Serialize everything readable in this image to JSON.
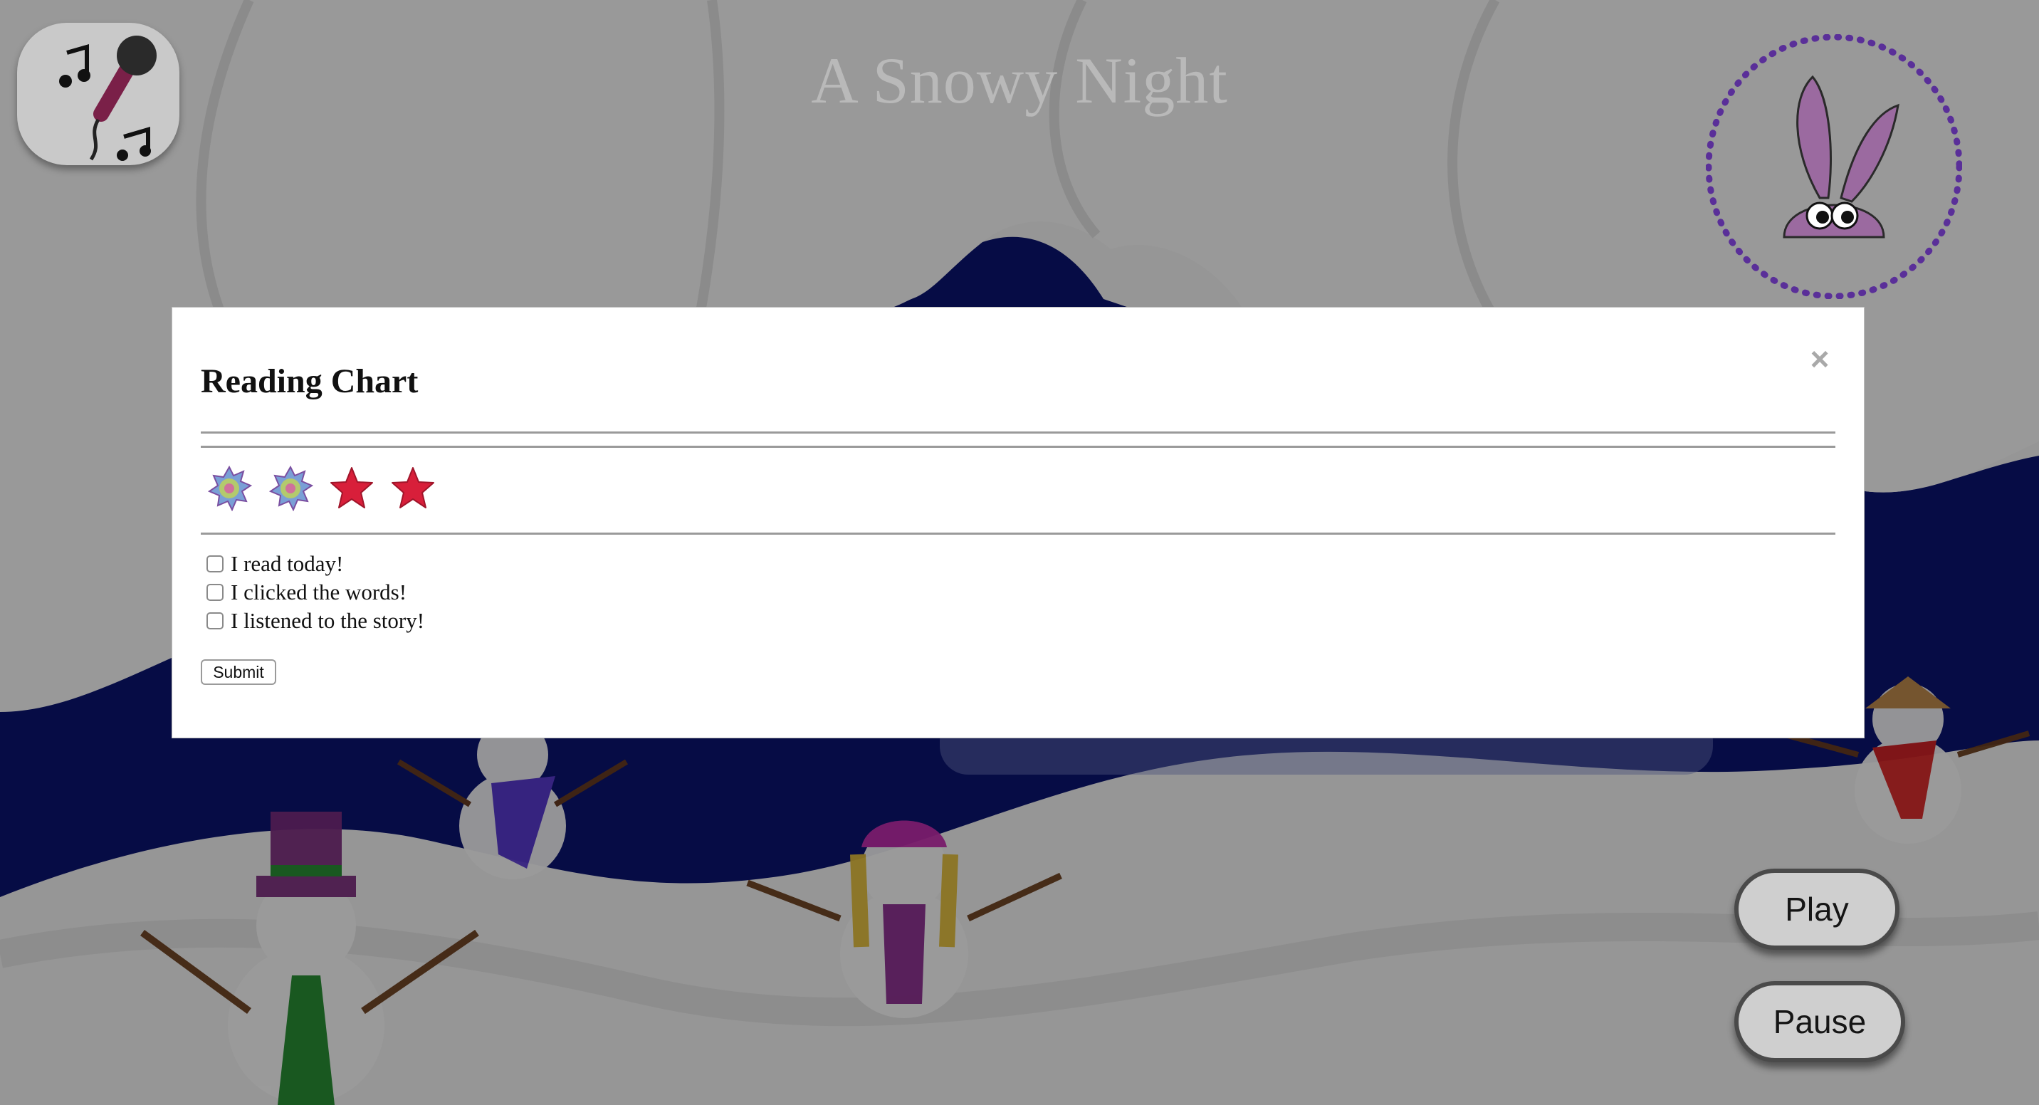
{
  "app": {
    "title": "A Snowy Night"
  },
  "controls": {
    "karaoke_icon": "microphone-music-icon",
    "mascot_icon": "bunny-icon",
    "play_label": "Play",
    "pause_label": "Pause"
  },
  "modal": {
    "title": "Reading Chart",
    "close_icon": "close-icon",
    "stickers": [
      {
        "icon": "snowflake-badge-icon"
      },
      {
        "icon": "snowflake-badge-icon"
      },
      {
        "icon": "red-star-icon"
      },
      {
        "icon": "red-star-icon"
      }
    ],
    "checklist": [
      {
        "label": "I read today!",
        "checked": false
      },
      {
        "label": "I clicked the words!",
        "checked": false
      },
      {
        "label": "I listened to the story!",
        "checked": false
      }
    ],
    "submit_label": "Submit"
  },
  "colors": {
    "night_sky": "#0b1470",
    "snow": "#f4f4f4",
    "star_red": "#d81f3a",
    "mascot_purple": "#9b6aa0",
    "dotted_ring": "#5a2f99"
  }
}
